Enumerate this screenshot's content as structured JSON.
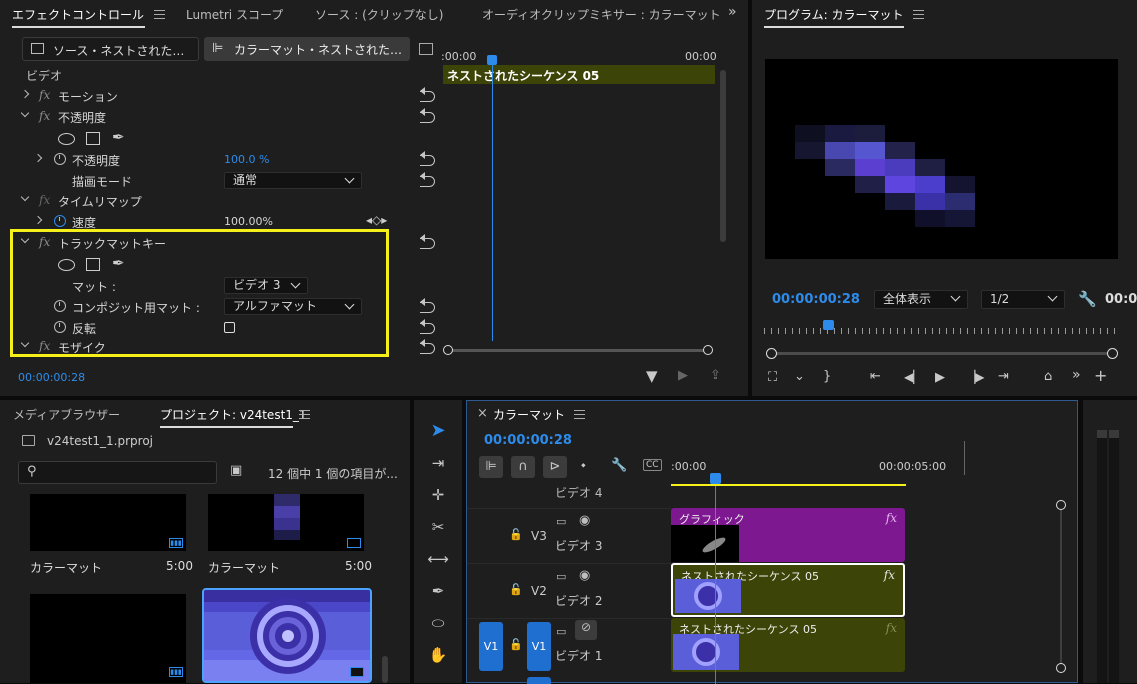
{
  "effect_controls": {
    "tabs": [
      "エフェクトコントロール",
      "Lumetri スコープ",
      "ソース : (クリップなし)",
      "オーディオクリップミキサー : カラーマット"
    ],
    "source_tab": "ソース・ネストされた…",
    "target_tab": "カラーマット・ネストされた…",
    "section_video": "ビデオ",
    "rows": {
      "motion": "モーション",
      "opacity": "不透明度",
      "opacity_param": "不透明度",
      "opacity_value": "100.0 %",
      "blend_mode_label": "描画モード",
      "blend_mode_value": "通常",
      "time_remap": "タイムリマップ",
      "speed_label": "速度",
      "speed_value": "100.00%",
      "track_matte": "トラックマットキー",
      "matte_label": "マット :",
      "matte_value": "ビデオ 3",
      "composite_label": "コンポジット用マット :",
      "composite_value": "アルファマット",
      "reverse_label": "反転",
      "mosaic": "モザイク"
    },
    "timecode": "00:00:00:28",
    "mini_timeline": {
      "start": ":00:00",
      "end": "00:00",
      "clip_label": "ネストされたシーケンス 05"
    }
  },
  "program": {
    "title": "プログラム: カラーマット",
    "timecode": "00:00:00:28",
    "zoom": "全体表示",
    "resolution": "1/2",
    "right_timecode": "00:0"
  },
  "project": {
    "tabs": [
      "メディアブラウザー",
      "プロジェクト: v24test1_1"
    ],
    "file": "v24test1_1.prproj",
    "item_count": "12 個中 1 個の項目が...",
    "items": [
      {
        "name": "カラーマット",
        "duration": "5:00"
      },
      {
        "name": "カラーマット",
        "duration": "5:00"
      }
    ]
  },
  "timeline": {
    "title": "カラーマット",
    "timecode": "00:00:00:28",
    "ruler_start": ":00:00",
    "ruler_mid": "00:00:05:00",
    "tracks": [
      {
        "id": "V4",
        "name": "ビデオ 4"
      },
      {
        "id": "V3",
        "name": "ビデオ 3"
      },
      {
        "id": "V2",
        "name": "ビデオ 2"
      },
      {
        "id": "V1",
        "name": "ビデオ 1",
        "source": "V1"
      }
    ],
    "clips": {
      "graphic": "グラフィック",
      "nested_v2": "ネストされたシーケンス 05",
      "nested_v1": "ネストされたシーケンス 05",
      "fx": "fx"
    }
  },
  "colors": {
    "accent_blue": "#2d8ceb",
    "highlight_yellow": "#f5f01a",
    "clip_olive": "#3d4407",
    "clip_purple": "#7d1890"
  }
}
